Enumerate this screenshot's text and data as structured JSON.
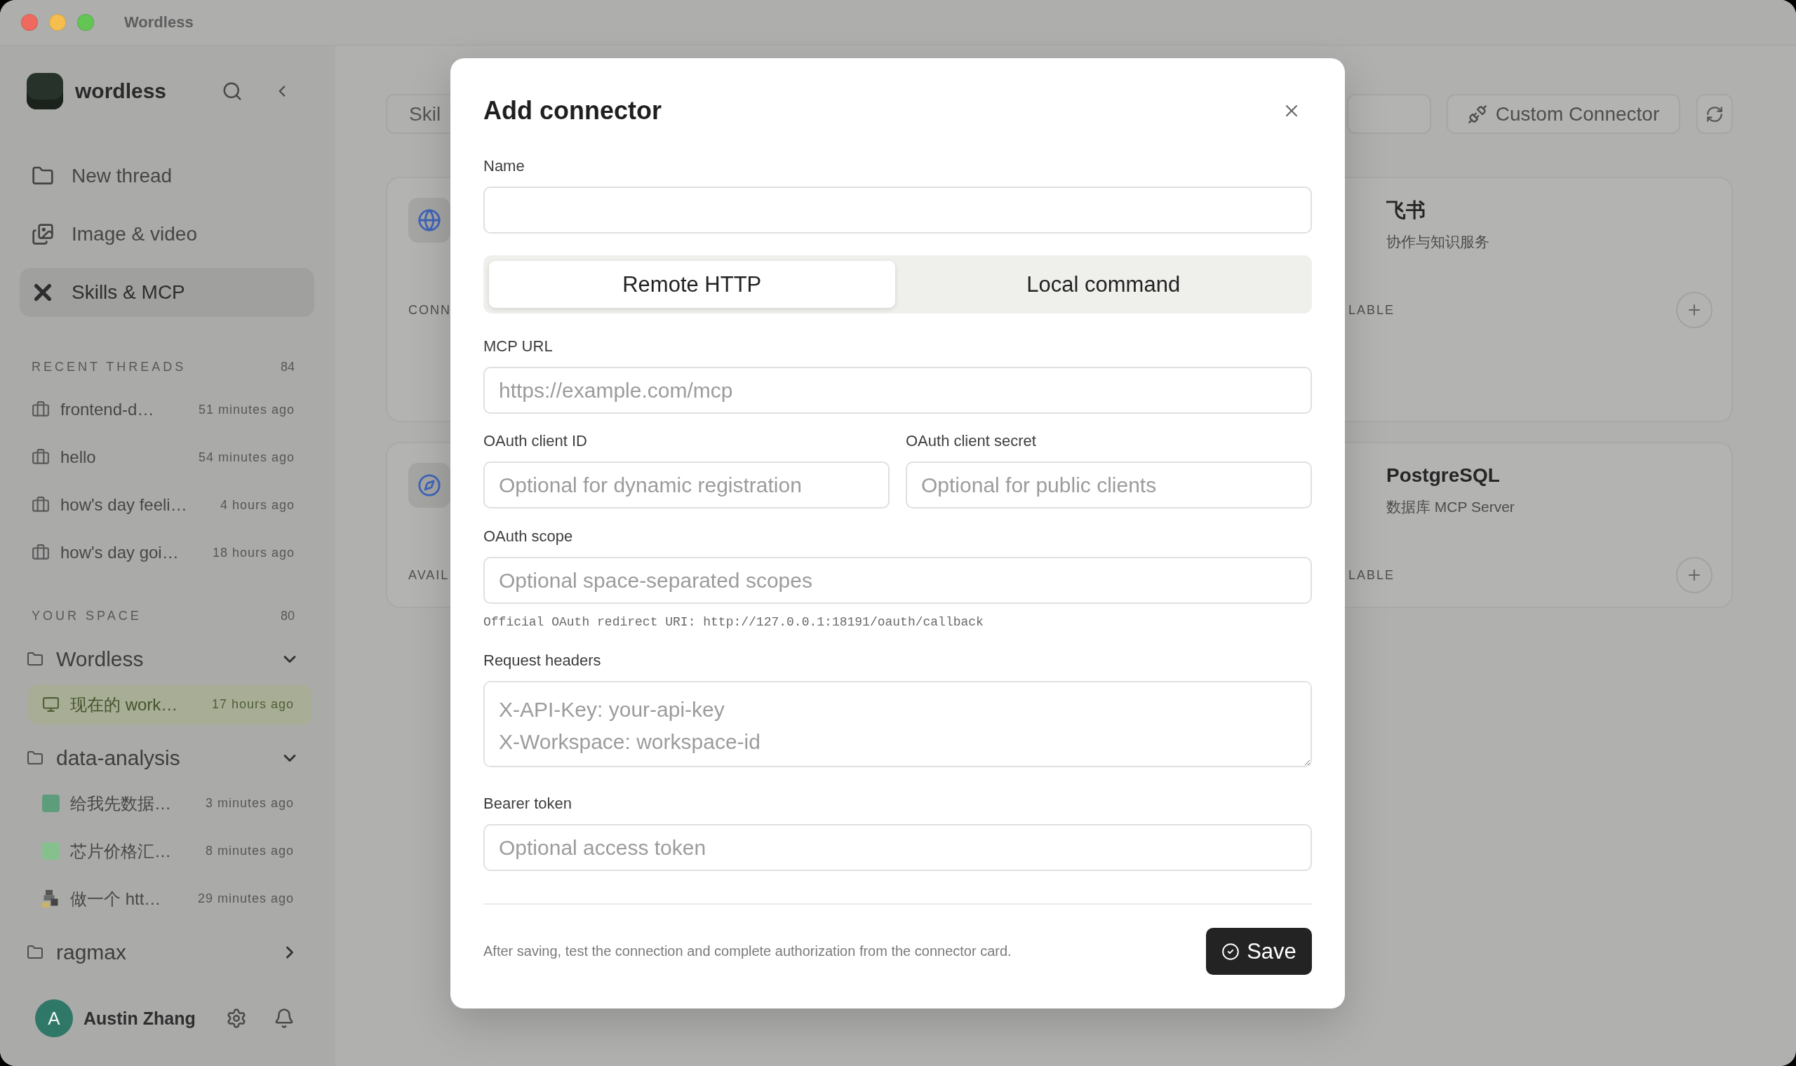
{
  "window": {
    "title": "Wordless"
  },
  "sidebar": {
    "brand": "wordless",
    "nav": [
      {
        "label": "New thread",
        "selected": false
      },
      {
        "label": "Image & video",
        "selected": false
      },
      {
        "label": "Skills & MCP",
        "selected": true
      }
    ],
    "recent": {
      "heading": "RECENT THREADS",
      "count": "84",
      "threads": [
        {
          "title": "frontend-d…",
          "time": "51 minutes ago"
        },
        {
          "title": "hello",
          "time": "54 minutes ago"
        },
        {
          "title": "how's day feeli…",
          "time": "4 hours ago"
        },
        {
          "title": "how's day goi…",
          "time": "18 hours ago"
        }
      ]
    },
    "spaces": {
      "heading": "YOUR SPACE",
      "count": "80",
      "folders": [
        {
          "name": "Wordless",
          "expanded": true,
          "children": [
            {
              "kind": "monitor",
              "title": "现在的 work…",
              "time": "17 hours ago",
              "selected": true
            }
          ]
        },
        {
          "name": "data-analysis",
          "expanded": true,
          "children": [
            {
              "kind": "square",
              "color": "#5e9d7c",
              "title": "给我先数据…",
              "time": "3 minutes ago",
              "selected": false
            },
            {
              "kind": "square",
              "color": "#86c08e",
              "title": "芯片价格汇…",
              "time": "8 minutes ago",
              "selected": false
            },
            {
              "kind": "sprite",
              "title": "做一个 htt…",
              "time": "29 minutes ago",
              "selected": false
            }
          ]
        },
        {
          "name": "ragmax",
          "expanded": false
        }
      ]
    },
    "user": {
      "initial": "A",
      "name": "Austin Zhang"
    }
  },
  "main": {
    "tab": "Skil",
    "custom_connector_button": "Custom Connector",
    "left_cards": [
      {
        "status": "CONN"
      },
      {
        "status": "AVAIL"
      }
    ],
    "right_cards": [
      {
        "title": "飞书",
        "subtitle": "协作与知识服务",
        "status": "LABLE"
      },
      {
        "title": "PostgreSQL",
        "subtitle": "数据库 MCP Server",
        "status": "LABLE"
      }
    ]
  },
  "dialog": {
    "title": "Add connector",
    "name_field": {
      "label": "Name"
    },
    "transport_tabs": [
      {
        "label": "Remote HTTP",
        "selected": true
      },
      {
        "label": "Local command",
        "selected": false
      }
    ],
    "mcp_url": {
      "label": "MCP URL",
      "placeholder": "https://example.com/mcp"
    },
    "oauth_client_id": {
      "label": "OAuth client ID",
      "placeholder": "Optional for dynamic registration"
    },
    "oauth_client_secret": {
      "label": "OAuth client secret",
      "placeholder": "Optional for public clients"
    },
    "oauth_scope": {
      "label": "OAuth scope",
      "placeholder": "Optional space-separated scopes"
    },
    "redirect_note": "Official OAuth redirect URI: http://127.0.0.1:18191/oauth/callback",
    "request_headers": {
      "label": "Request headers",
      "placeholder": "X-API-Key: your-api-key\nX-Workspace: workspace-id"
    },
    "bearer_token": {
      "label": "Bearer token",
      "placeholder": "Optional access token"
    },
    "footer_note": "After saving, test the connection and complete authorization from the connector card.",
    "save_button": "Save"
  }
}
